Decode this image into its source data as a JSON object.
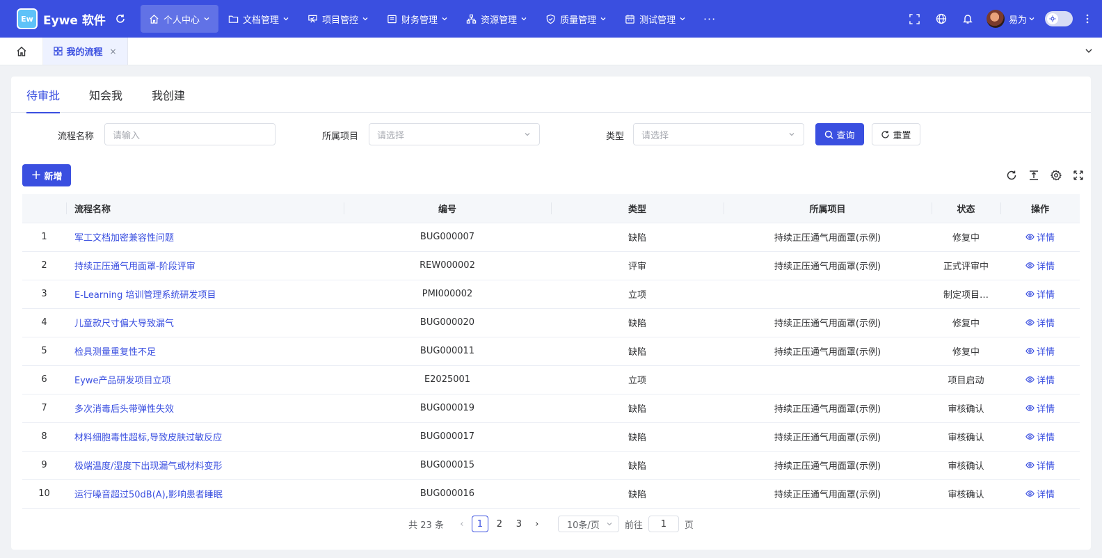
{
  "app": {
    "logo_text": "Ew",
    "brand": "Eywe 软件"
  },
  "nav": {
    "items": [
      {
        "label": "个人中心",
        "icon": "home-icon",
        "active": true
      },
      {
        "label": "文档管理",
        "icon": "folder-icon"
      },
      {
        "label": "项目管控",
        "icon": "project-icon"
      },
      {
        "label": "财务管理",
        "icon": "finance-icon"
      },
      {
        "label": "资源管理",
        "icon": "resource-icon"
      },
      {
        "label": "质量管理",
        "icon": "shield-icon"
      },
      {
        "label": "测试管理",
        "icon": "calendar-icon"
      }
    ],
    "more": "···"
  },
  "user": {
    "name": "易为"
  },
  "tabbar": {
    "active_tab": "我的流程",
    "close": "×"
  },
  "subtabs": [
    "待审批",
    "知会我",
    "我创建"
  ],
  "filters": {
    "name_label": "流程名称",
    "name_placeholder": "请输入",
    "project_label": "所属项目",
    "project_placeholder": "请选择",
    "type_label": "类型",
    "type_placeholder": "请选择",
    "query_label": "查询",
    "reset_label": "重置"
  },
  "toolbar": {
    "add_label": "新增"
  },
  "table": {
    "columns": [
      "",
      "流程名称",
      "编号",
      "类型",
      "所属项目",
      "状态",
      "操作"
    ],
    "op_label": "详情",
    "rows": [
      {
        "idx": "1",
        "name": "军工文档加密兼容性问题",
        "code": "BUG000007",
        "type": "缺陷",
        "project": "持续正压通气用面罩(示例)",
        "status": "修复中"
      },
      {
        "idx": "2",
        "name": "持续正压通气用面罩-阶段评审",
        "code": "REW000002",
        "type": "评审",
        "project": "持续正压通气用面罩(示例)",
        "status": "正式评审中"
      },
      {
        "idx": "3",
        "name": "E-Learning 培训管理系统研发项目",
        "code": "PMI000002",
        "type": "立项",
        "project": "",
        "status": "制定项目…"
      },
      {
        "idx": "4",
        "name": "儿童款尺寸偏大导致漏气",
        "code": "BUG000020",
        "type": "缺陷",
        "project": "持续正压通气用面罩(示例)",
        "status": "修复中"
      },
      {
        "idx": "5",
        "name": "检具测量重复性不足",
        "code": "BUG000011",
        "type": "缺陷",
        "project": "持续正压通气用面罩(示例)",
        "status": "修复中"
      },
      {
        "idx": "6",
        "name": "Eywe产品研发项目立项",
        "code": "E2025001",
        "type": "立项",
        "project": "",
        "status": "项目启动"
      },
      {
        "idx": "7",
        "name": "多次消毒后头带弹性失效",
        "code": "BUG000019",
        "type": "缺陷",
        "project": "持续正压通气用面罩(示例)",
        "status": "审核确认"
      },
      {
        "idx": "8",
        "name": "材料细胞毒性超标,导致皮肤过敏反应",
        "code": "BUG000017",
        "type": "缺陷",
        "project": "持续正压通气用面罩(示例)",
        "status": "审核确认"
      },
      {
        "idx": "9",
        "name": "极端温度/湿度下出现漏气或材料变形",
        "code": "BUG000015",
        "type": "缺陷",
        "project": "持续正压通气用面罩(示例)",
        "status": "审核确认"
      },
      {
        "idx": "10",
        "name": "运行噪音超过50dB(A),影响患者睡眠",
        "code": "BUG000016",
        "type": "缺陷",
        "project": "持续正压通气用面罩(示例)",
        "status": "审核确认"
      }
    ]
  },
  "pagination": {
    "total": "共 23 条",
    "pages": [
      "1",
      "2",
      "3"
    ],
    "current": "1",
    "page_size": "10条/页",
    "goto_label": "前往",
    "goto_value": "1",
    "page_unit": "页"
  },
  "colors": {
    "primary": "#3a4fe0",
    "topbar": "#3a4fe0"
  }
}
